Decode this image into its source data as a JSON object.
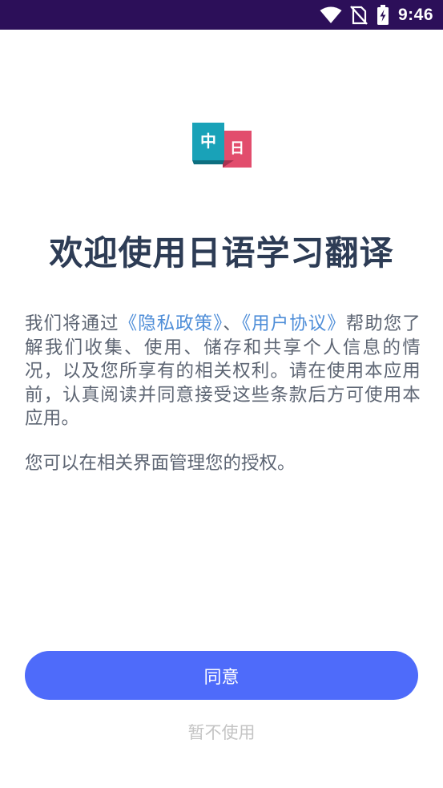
{
  "status_bar": {
    "time": "9:46",
    "icons": [
      "wifi-icon",
      "no-sim-icon",
      "battery-charging-icon"
    ],
    "background": "#2c0f59"
  },
  "logo": {
    "left_char": "中",
    "right_char": "日",
    "colors": {
      "teal": "#19a2b8",
      "red": "#e24d6d"
    }
  },
  "title": "欢迎使用日语学习翻译",
  "policy": {
    "prefix": "我们将通过",
    "privacy_link": "《隐私政策》",
    "separator": "、",
    "agreement_link": "《用户协议》",
    "suffix": "帮助您了解我们收集、使用、储存和共享个人信息的情况，以及您所享有的相关权利。请在使用本应用前，认真阅读并同意接受这些条款后方可使用本应用。"
  },
  "auth_note": "您可以在相关界面管理您的授权。",
  "buttons": {
    "agree": "同意",
    "decline": "暂不使用"
  },
  "colors": {
    "accent": "#4e6bfa",
    "link": "#4f8ed8",
    "title": "#2d3c55",
    "body_text": "#5d6573",
    "decline": "#c4c4c4"
  }
}
